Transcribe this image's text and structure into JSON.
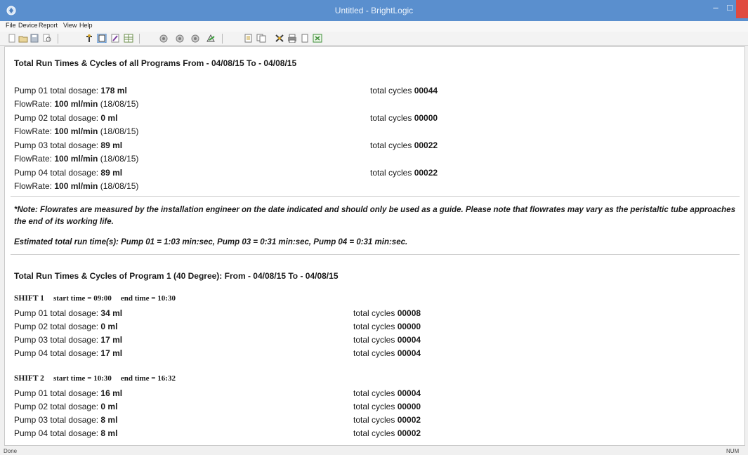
{
  "window": {
    "title": "Untitled - BrightLogic"
  },
  "menu": [
    "File",
    "Device",
    "Report",
    "View",
    "Help"
  ],
  "report": {
    "summary": {
      "heading": "Total Run Times & Cycles of all Programs From - 04/08/15 To - 04/08/15",
      "pumps": [
        {
          "label": "Pump 01 total dosage: ",
          "dosage": "178 ml",
          "cycles_label": "total cycles ",
          "cycles": "00044",
          "flow_label": "FlowRate: ",
          "flow": "100 ml/min",
          "flow_date": " (18/08/15)"
        },
        {
          "label": "Pump 02 total dosage: ",
          "dosage": "0 ml",
          "cycles_label": "total cycles ",
          "cycles": "00000",
          "flow_label": "FlowRate: ",
          "flow": "100 ml/min",
          "flow_date": " (18/08/15)"
        },
        {
          "label": "Pump 03 total dosage: ",
          "dosage": "89 ml",
          "cycles_label": "total cycles ",
          "cycles": "00022",
          "flow_label": "FlowRate: ",
          "flow": "100 ml/min",
          "flow_date": " (18/08/15)"
        },
        {
          "label": "Pump 04 total dosage: ",
          "dosage": "89 ml",
          "cycles_label": "total cycles ",
          "cycles": "00022",
          "flow_label": "FlowRate: ",
          "flow": "100 ml/min",
          "flow_date": " (18/08/15)"
        }
      ]
    },
    "note": "*Note: Flowrates are measured by the installation engineer on the date indicated and should only be used as a guide. Please note that flowrates may vary as the peristaltic tube approaches the end of its working life.",
    "estimate": "Estimated total run time(s): Pump 01 = 1:03 min:sec, Pump 03 = 0:31 min:sec, Pump 04 = 0:31 min:sec.",
    "program": {
      "heading": "Total Run Times & Cycles of Program 1 (40 Degree): From - 04/08/15 To - 04/08/15",
      "shifts": [
        {
          "name": "SHIFT 1",
          "start": "start time = 09:00",
          "end": "end time = 10:30",
          "rows": [
            {
              "label": "Pump 01 total dosage: ",
              "dosage": "34 ml",
              "cycles_label": "total cycles ",
              "cycles": "00008"
            },
            {
              "label": "Pump 02 total dosage: ",
              "dosage": "0 ml",
              "cycles_label": "total cycles ",
              "cycles": "00000"
            },
            {
              "label": "Pump 03 total dosage: ",
              "dosage": "17 ml",
              "cycles_label": "total cycles ",
              "cycles": "00004"
            },
            {
              "label": "Pump 04 total dosage: ",
              "dosage": "17 ml",
              "cycles_label": "total cycles ",
              "cycles": "00004"
            }
          ]
        },
        {
          "name": "SHIFT 2",
          "start": "start time = 10:30",
          "end": "end time = 16:32",
          "rows": [
            {
              "label": "Pump 01 total dosage: ",
              "dosage": "16 ml",
              "cycles_label": "total cycles ",
              "cycles": "00004"
            },
            {
              "label": "Pump 02 total dosage: ",
              "dosage": "0 ml",
              "cycles_label": "total cycles ",
              "cycles": "00000"
            },
            {
              "label": "Pump 03 total dosage: ",
              "dosage": "8 ml",
              "cycles_label": "total cycles ",
              "cycles": "00002"
            },
            {
              "label": "Pump 04 total dosage: ",
              "dosage": "8 ml",
              "cycles_label": "total cycles ",
              "cycles": "00002"
            }
          ]
        }
      ]
    }
  },
  "statusbar": {
    "text": "Done",
    "num": "NUM"
  },
  "colors": {
    "titlebar": "#5a8fce",
    "close": "#e04a3f"
  },
  "icons": [
    "new-icon",
    "open-icon",
    "save-icon",
    "print-preview-icon",
    "connect-icon",
    "report-icon",
    "edit-icon",
    "table-icon",
    "pump-icon",
    "pump-icon",
    "pump-icon",
    "run-icon",
    "document-icon",
    "copy-icon",
    "settings-icon",
    "print-icon",
    "page-icon",
    "export-icon"
  ]
}
